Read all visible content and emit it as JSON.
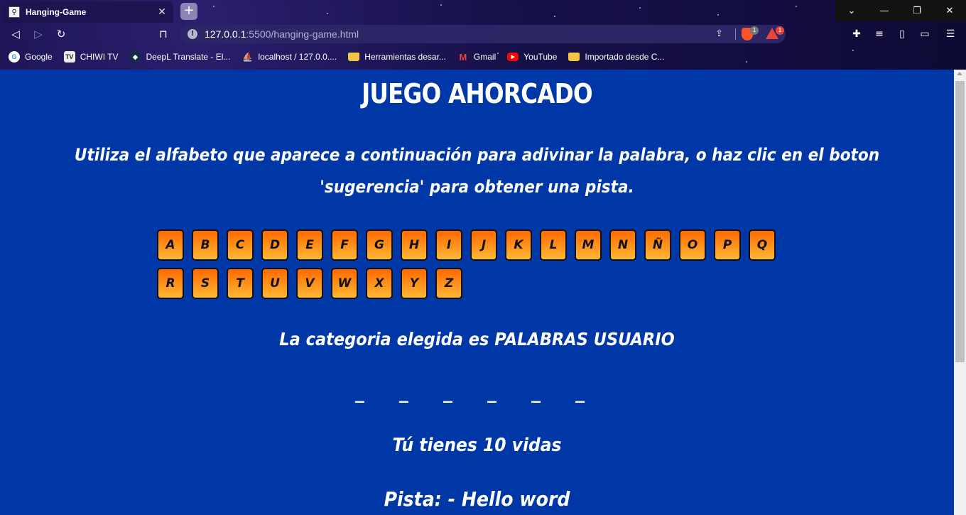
{
  "browser": {
    "tab_title": "Hanging-Game",
    "new_tab": "+",
    "url_host": "127.0.0.1",
    "url_path": ":5500/hanging-game.html",
    "shield_badge": "1",
    "alert_badge": "1"
  },
  "bookmarks": [
    {
      "label": "Google",
      "icon": "google-icon"
    },
    {
      "label": "CHIWI TV",
      "icon": "tv-icon"
    },
    {
      "label": "DeepL Translate - El...",
      "icon": "deepl-icon"
    },
    {
      "label": "localhost / 127.0.0....",
      "icon": "phpmyadmin-icon"
    },
    {
      "label": "Herramientas desar...",
      "icon": "folder-icon"
    },
    {
      "label": "Gmail",
      "icon": "gmail-icon"
    },
    {
      "label": "YouTube",
      "icon": "youtube-icon"
    },
    {
      "label": "Importado desde C...",
      "icon": "folder-icon"
    }
  ],
  "game": {
    "title": "JUEGO AHORCADO",
    "instructions": "Utiliza el alfabeto que aparece a continuación para adivinar la palabra, o haz clic en el boton 'sugerencia' para obtener una pista.",
    "letters_row1": [
      "A",
      "B",
      "C",
      "D",
      "E",
      "F",
      "G",
      "H",
      "I",
      "J",
      "K",
      "L",
      "M",
      "N",
      "Ñ",
      "O",
      "P",
      "Q"
    ],
    "letters_row2": [
      "R",
      "S",
      "T",
      "U",
      "V",
      "W",
      "X",
      "Y",
      "Z"
    ],
    "category": "La categoria elegida es PALABRAS USUARIO",
    "word": "_ _ _ _ _ _",
    "lives": "Tú tienes 10 vidas",
    "hint": "Pista: - Hello word"
  },
  "colors": {
    "page_bg": "#0037a6",
    "key_top": "#ff6a00",
    "key_bottom": "#ffb836"
  }
}
